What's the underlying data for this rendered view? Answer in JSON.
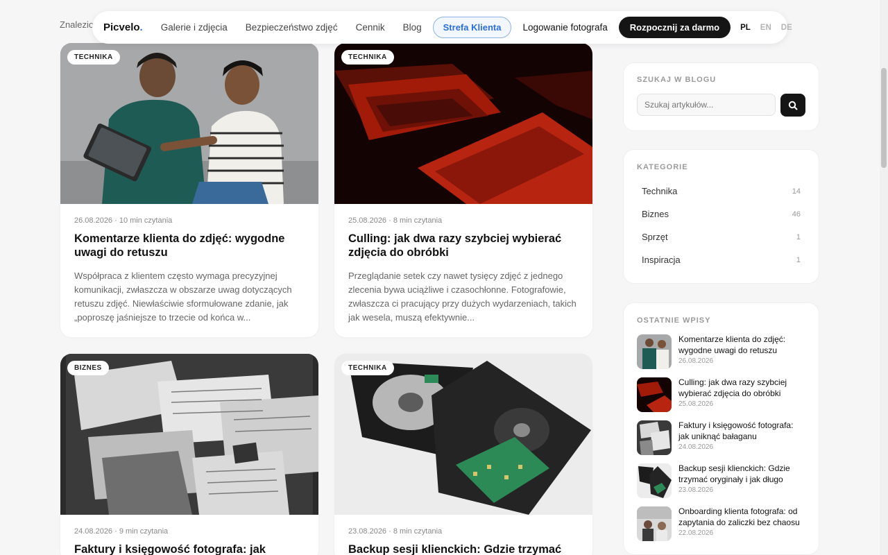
{
  "background_text": "Znalezio",
  "nav": {
    "logo": "Picvelo",
    "logo_dot": ".",
    "links": [
      "Galerie i zdjęcia",
      "Bezpieczeństwo zdjęć",
      "Cennik",
      "Blog"
    ],
    "client_zone": "Strefa Klienta",
    "login": "Logowanie fotografa",
    "cta": "Rozpocznij za darmo",
    "languages": [
      "PL",
      "EN",
      "DE"
    ],
    "active_language": "PL"
  },
  "posts": [
    {
      "tag": "TECHNIKA",
      "meta": "26.08.2026 · 10 min czytania",
      "title": "Komentarze klienta do zdjęć: wygodne uwagi do retuszu",
      "excerpt": "Współpraca z klientem często wymaga precyzyjnej komunikacji, zwłaszcza w obszarze uwag dotyczących retuszu zdjęć. Niewłaściwie sformułowane zdanie, jak „poproszę jaśniejsze to trzecie od końca w..."
    },
    {
      "tag": "TECHNIKA",
      "meta": "25.08.2026 · 8 min czytania",
      "title": "Culling: jak dwa razy szybciej wybierać zdjęcia do obróbki",
      "excerpt": "Przeglądanie setek czy nawet tysięcy zdjęć z jednego zlecenia bywa uciążliwe i czasochłonne. Fotografowie, zwłaszcza ci pracujący przy dużych wydarzeniach, takich jak wesela, muszą efektywnie..."
    },
    {
      "tag": "BIZNES",
      "meta": "24.08.2026 · 9 min czytania",
      "title": "Faktury i księgowość fotografa: jak",
      "excerpt": ""
    },
    {
      "tag": "TECHNIKA",
      "meta": "23.08.2026 · 8 min czytania",
      "title": "Backup sesji klienckich: Gdzie trzymać",
      "excerpt": ""
    }
  ],
  "sidebar": {
    "search": {
      "heading": "SZUKAJ W BLOGU",
      "placeholder": "Szukaj artykułów..."
    },
    "categories": {
      "heading": "KATEGORIE",
      "items": [
        {
          "name": "Technika",
          "count": "14"
        },
        {
          "name": "Biznes",
          "count": "46"
        },
        {
          "name": "Sprzęt",
          "count": "1"
        },
        {
          "name": "Inspiracja",
          "count": "1"
        }
      ]
    },
    "recent": {
      "heading": "OSTATNIE WPISY",
      "items": [
        {
          "title": "Komentarze klienta do zdjęć: wygodne uwagi do retuszu",
          "date": "26.08.2026"
        },
        {
          "title": "Culling: jak dwa razy szybciej wybierać zdjęcia do obróbki",
          "date": "25.08.2026"
        },
        {
          "title": "Faktury i księgowość fotografa: jak uniknąć bałaganu",
          "date": "24.08.2026"
        },
        {
          "title": "Backup sesji klienckich: Gdzie trzymać oryginały i jak długo",
          "date": "23.08.2026"
        },
        {
          "title": "Onboarding klienta fotografa: od zapytania do zaliczki bez chaosu",
          "date": "22.08.2026"
        }
      ]
    }
  }
}
